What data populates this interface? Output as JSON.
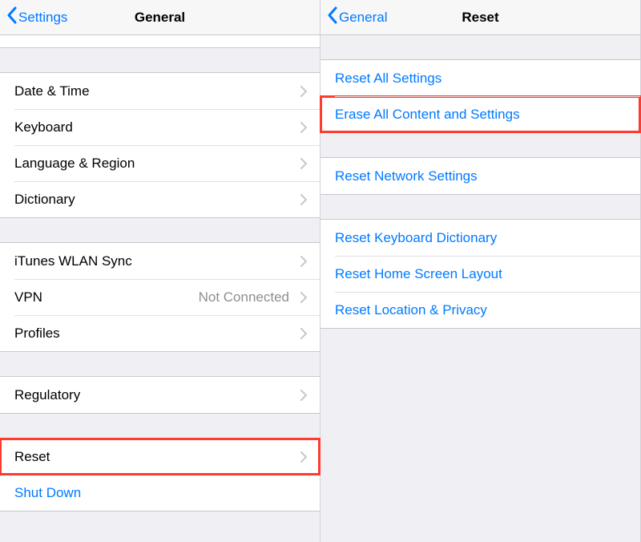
{
  "left": {
    "back": "Settings",
    "title": "General",
    "groups": [
      {
        "type": "cutoff"
      },
      {
        "type": "gap"
      },
      {
        "type": "group",
        "cells": [
          {
            "label": "Date & Time",
            "chevron": true
          },
          {
            "label": "Keyboard",
            "chevron": true
          },
          {
            "label": "Language & Region",
            "chevron": true
          },
          {
            "label": "Dictionary",
            "chevron": true
          }
        ]
      },
      {
        "type": "gap"
      },
      {
        "type": "group",
        "cells": [
          {
            "label": "iTunes WLAN Sync",
            "chevron": true
          },
          {
            "label": "VPN",
            "detail": "Not Connected",
            "chevron": true
          },
          {
            "label": "Profiles",
            "chevron": true
          }
        ]
      },
      {
        "type": "gap"
      },
      {
        "type": "group",
        "cells": [
          {
            "label": "Regulatory",
            "chevron": true
          }
        ]
      },
      {
        "type": "gap"
      },
      {
        "type": "group",
        "cells": [
          {
            "label": "Reset",
            "chevron": true,
            "highlight": true
          },
          {
            "label": "Shut Down",
            "blue": true
          }
        ]
      }
    ]
  },
  "right": {
    "back": "General",
    "title": "Reset",
    "groups": [
      {
        "type": "gap"
      },
      {
        "type": "group",
        "cells": [
          {
            "label": "Reset All Settings",
            "blue": true
          },
          {
            "label": "Erase All Content and Settings",
            "blue": true,
            "highlight": true
          }
        ]
      },
      {
        "type": "gap"
      },
      {
        "type": "group",
        "cells": [
          {
            "label": "Reset Network Settings",
            "blue": true
          }
        ]
      },
      {
        "type": "gap"
      },
      {
        "type": "group",
        "cells": [
          {
            "label": "Reset Keyboard Dictionary",
            "blue": true
          },
          {
            "label": "Reset Home Screen Layout",
            "blue": true
          },
          {
            "label": "Reset Location & Privacy",
            "blue": true
          }
        ]
      }
    ]
  }
}
